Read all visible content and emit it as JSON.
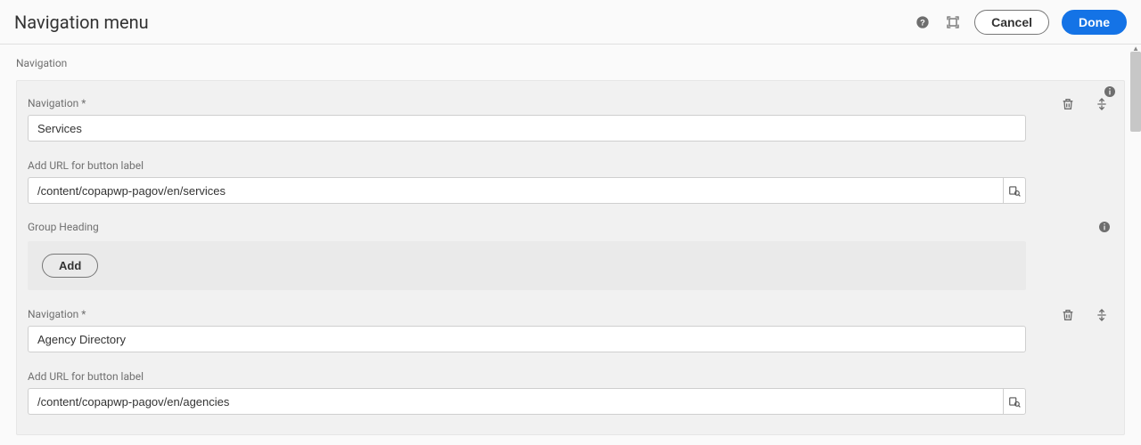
{
  "header": {
    "title": "Navigation menu",
    "cancel_label": "Cancel",
    "done_label": "Done"
  },
  "section_label": "Navigation",
  "labels": {
    "navigation_required": "Navigation *",
    "add_url": "Add URL for button label",
    "group_heading": "Group Heading",
    "add_btn": "Add"
  },
  "items": [
    {
      "name": "Services",
      "url": "/content/copapwp-pagov/en/services"
    },
    {
      "name": "Agency Directory",
      "url": "/content/copapwp-pagov/en/agencies"
    }
  ],
  "icons": {
    "help": "help-icon",
    "fullscreen": "fullscreen-icon",
    "info": "info-icon",
    "trash": "trash-icon",
    "reorder": "reorder-icon",
    "pathpicker": "path-picker-icon"
  }
}
